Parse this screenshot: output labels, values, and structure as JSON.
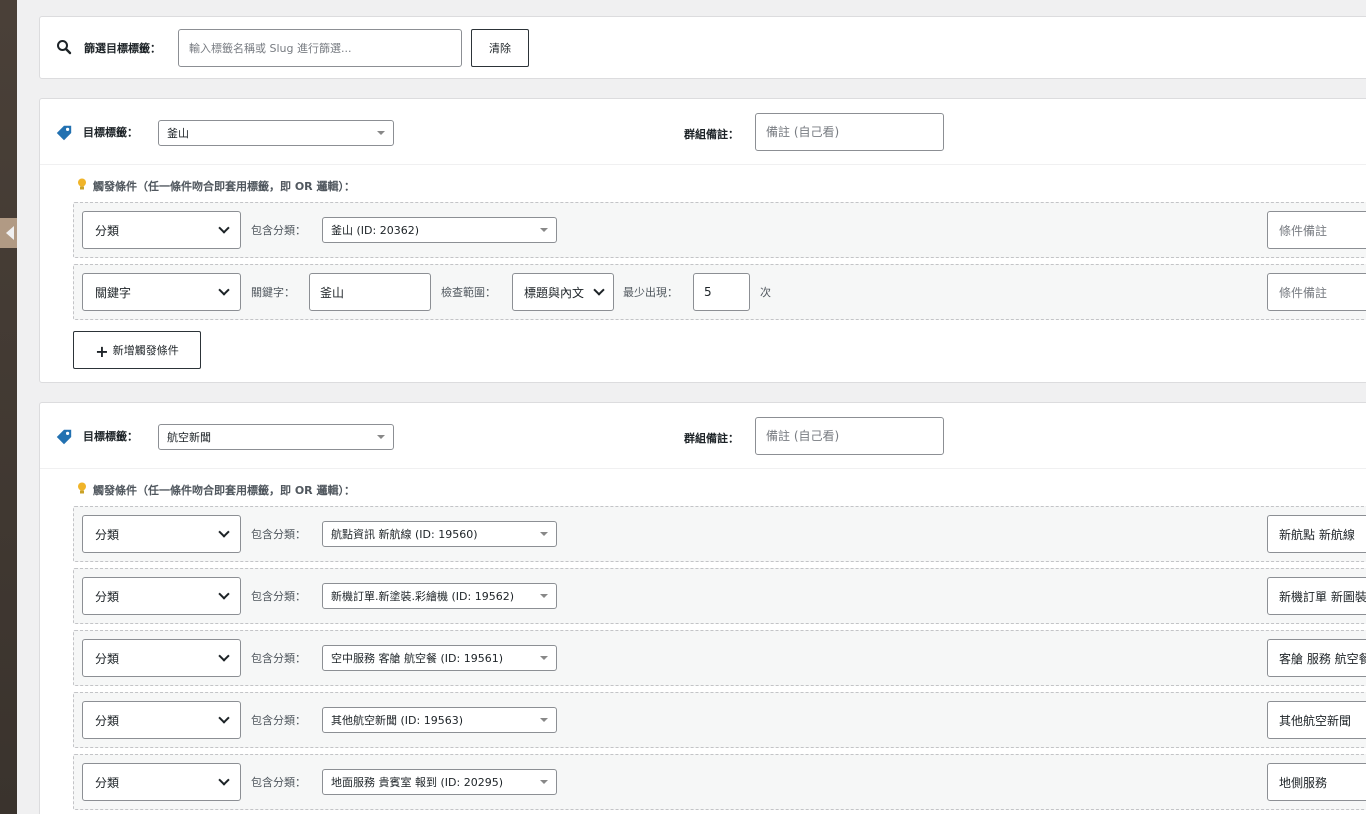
{
  "filter": {
    "label": "篩選目標標籤：",
    "placeholder": "輸入標籤名稱或 Slug 進行篩選...",
    "clear_label": "清除"
  },
  "groups": [
    {
      "target_label": "目標標籤：",
      "target_value": "釜山",
      "note_label": "群組備註：",
      "note_placeholder": "備註 (自己看)",
      "trigger_heading": "觸發條件（任一條件吻合即套用標籤，即 OR 邏輯）：",
      "add_label": "新增觸發條件",
      "conditions": [
        {
          "type": "分類",
          "include_label": "包含分類：",
          "category": "釜山 (ID: 20362)",
          "note_placeholder": "條件備註",
          "note_value": ""
        },
        {
          "type": "關鍵字",
          "keyword_label": "關鍵字：",
          "keyword": "釜山",
          "scope_label": "檢查範圍：",
          "scope": "標題與內文",
          "min_label": "最少出現：",
          "min_count": "5",
          "times_label": "次",
          "note_placeholder": "條件備註",
          "note_value": ""
        }
      ]
    },
    {
      "target_label": "目標標籤：",
      "target_value": "航空新聞",
      "note_label": "群組備註：",
      "note_placeholder": "備註 (自己看)",
      "trigger_heading": "觸發條件（任一條件吻合即套用標籤，即 OR 邏輯）：",
      "conditions": [
        {
          "type": "分類",
          "include_label": "包含分類：",
          "category": "航點資訊 新航線 (ID: 19560)",
          "note_value": "新航點 新航線"
        },
        {
          "type": "分類",
          "include_label": "包含分類：",
          "category": "新機訂單.新塗裝.彩繪機 (ID: 19562)",
          "note_value": "新機訂單 新圖裝"
        },
        {
          "type": "分類",
          "include_label": "包含分類：",
          "category": "空中服務 客艙 航空餐 (ID: 19561)",
          "note_value": "客艙 服務 航空餐"
        },
        {
          "type": "分類",
          "include_label": "包含分類：",
          "category": "其他航空新聞 (ID: 19563)",
          "note_value": "其他航空新聞"
        },
        {
          "type": "分類",
          "include_label": "包含分類：",
          "category": "地面服務 貴賓室 報到 (ID: 20295)",
          "note_value": "地側服務"
        }
      ]
    }
  ],
  "colors": {
    "accent": "#2271b1",
    "bulb": "#f0b429",
    "sidebar": "#3f3730",
    "sidebar_tab": "#b19a84"
  }
}
